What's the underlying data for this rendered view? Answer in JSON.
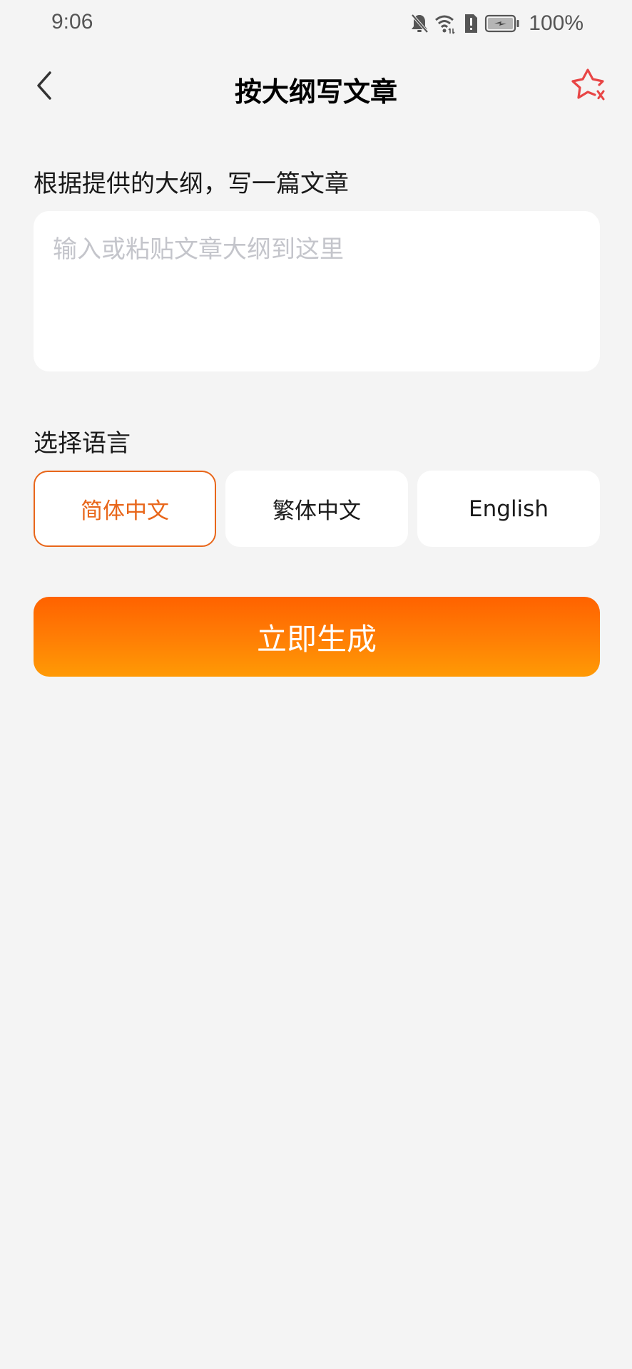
{
  "status_bar": {
    "time": "9:06",
    "icons": [
      "bell-muted-icon",
      "wifi-icon",
      "sim-alert-icon",
      "battery-charging-icon"
    ],
    "battery_percent": "100%"
  },
  "header": {
    "back_icon": "chevron-left-icon",
    "title": "按大纲写文章",
    "favorite_icon": "star-remove-icon"
  },
  "outline": {
    "label": "根据提供的大纲，写一篇文章",
    "value": "",
    "placeholder": "输入或粘贴文章大纲到这里"
  },
  "language": {
    "label": "选择语言",
    "options": [
      {
        "label": "简体中文",
        "selected": true
      },
      {
        "label": "繁体中文",
        "selected": false
      },
      {
        "label": "English",
        "selected": false
      }
    ]
  },
  "generate_button": {
    "label": "立即生成"
  },
  "colors": {
    "background": "#f4f4f4",
    "accent": "#e8661a",
    "button_gradient_top": "#ff6200",
    "button_gradient_bottom": "#ff9a05",
    "favorite_icon": "#e84545",
    "placeholder": "#c4c5cb"
  }
}
